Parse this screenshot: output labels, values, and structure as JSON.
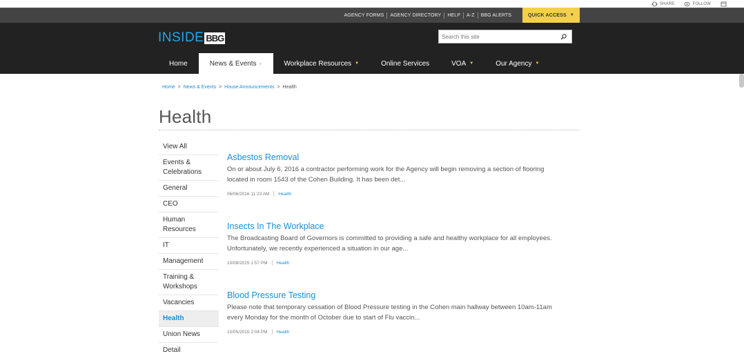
{
  "suitebar": {
    "share_label": "SHARE",
    "follow_label": "FOLLOW"
  },
  "utility": {
    "links": [
      "AGENCY FORMS",
      "AGENCY DIRECTORY",
      "HELP",
      "A-Z",
      "BBG ALERTS"
    ],
    "quick_access_label": "QUICK ACCESS",
    "accent_color": "#f2d04b"
  },
  "header": {
    "logo_text": "INSIDE",
    "logo_mark": "BBG",
    "search_placeholder": "Search this site"
  },
  "nav": {
    "items": [
      {
        "label": "Home",
        "arrow": ""
      },
      {
        "label": "News & Events",
        "arrow": "▸"
      },
      {
        "label": "Workplace Resources",
        "arrow": "▼"
      },
      {
        "label": "Online Services",
        "arrow": ""
      },
      {
        "label": "VOA",
        "arrow": "▼"
      },
      {
        "label": "Our Agency",
        "arrow": "▼"
      }
    ],
    "active_index": 1
  },
  "breadcrumb": {
    "items": [
      "Home",
      "News & Events",
      "House Announcements"
    ],
    "current": "Health",
    "separator": ">"
  },
  "page": {
    "title": "Health"
  },
  "sidebar": {
    "items": [
      "View All",
      "Events & Celebrations",
      "General",
      "CEO",
      "Human Resources",
      "IT",
      "Management",
      "Training & Workshops",
      "Vacancies",
      "Health",
      "Union News",
      "Detail Opportunities"
    ],
    "active_index": 9
  },
  "articles": [
    {
      "title": "Asbestos Removal",
      "summary": "On or about July 6, 2016 a contractor performing work for the Agency will begin removing a section of flooring located in room 1543 of the Cohen Building. It has been det...",
      "date": "06/06/2016 11:23 AM",
      "category": "Health"
    },
    {
      "title": "Insects In The Workplace",
      "summary": "The Broadcasting Board of Governors is committed to providing a safe and healthy workplace for all employees. Unfortunately, we recently experienced a situation in our age...",
      "date": "10/08/2015 1:57 PM",
      "category": "Health"
    },
    {
      "title": "Blood Pressure Testing",
      "summary": "Please note that temporary cessation of Blood Pressure testing in the Cohen main hallway between 10am-11am every Monday for the month of October due to start of Flu vaccin...",
      "date": "10/05/2015 2:04 PM",
      "category": "Health"
    }
  ],
  "colors": {
    "link": "#1a8fd6",
    "header_bg": "#222222",
    "utility_bg": "#444444"
  }
}
